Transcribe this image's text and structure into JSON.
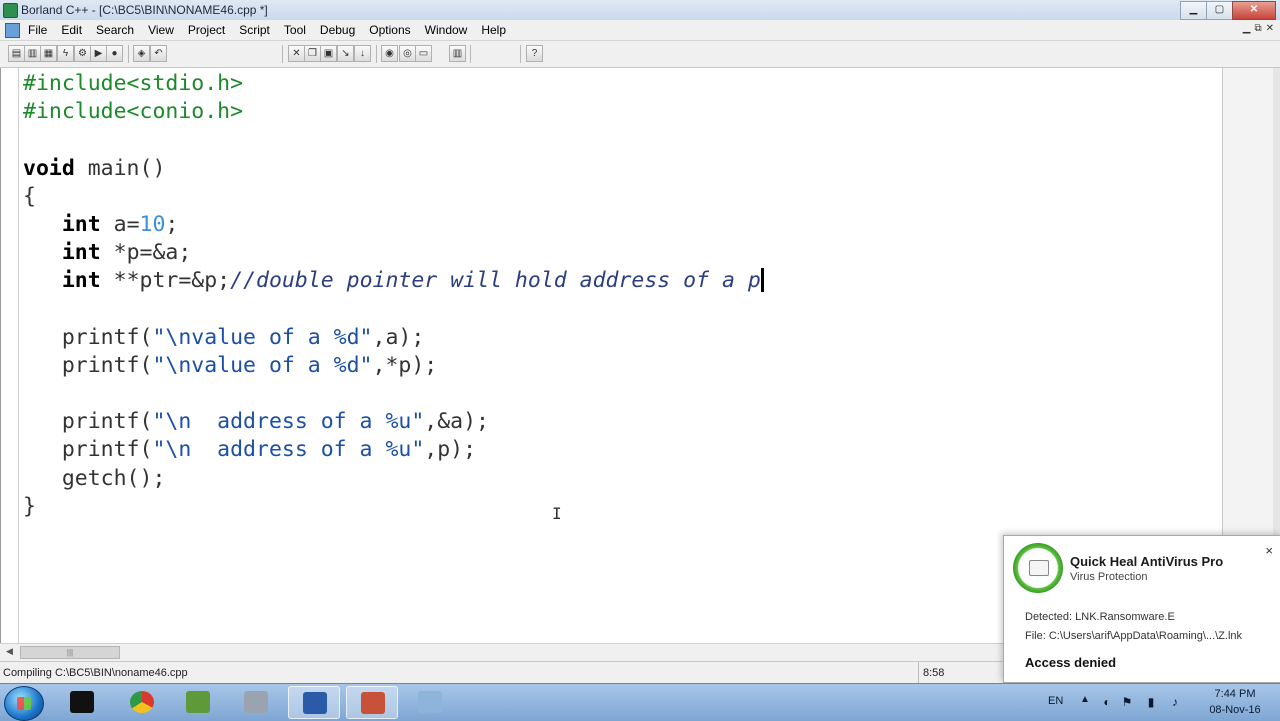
{
  "window": {
    "title": "Borland C++ - [C:\\BC5\\BIN\\NONAME46.cpp *]",
    "controls": {
      "minimize": "▁",
      "maximize": "▢",
      "close": "✕"
    },
    "mdi_controls": {
      "minimize": "▁",
      "restore": "⧉",
      "close": "✕"
    }
  },
  "menu": [
    "File",
    "Edit",
    "Search",
    "View",
    "Project",
    "Script",
    "Tool",
    "Debug",
    "Options",
    "Window",
    "Help"
  ],
  "toolbar": {
    "icons": [
      "new-icon",
      "open-icon",
      "project-icon",
      "compile-icon",
      "make-icon",
      "run-icon",
      "stop-icon",
      "debug-icon",
      "undo-icon",
      "cut-icon",
      "copy-icon",
      "paste-icon",
      "step-icon",
      "trace-icon",
      "breakpoint-icon",
      "watch-icon",
      "window-icon",
      "tile-icon",
      "help-icon"
    ]
  },
  "code": {
    "lines": [
      [
        {
          "t": "pp",
          "v": "#include<stdio.h>"
        }
      ],
      [
        {
          "t": "pp",
          "v": "#include<conio.h>"
        }
      ],
      [],
      [
        {
          "t": "kw",
          "v": "void"
        },
        {
          "t": "p",
          "v": " main()"
        }
      ],
      [
        {
          "t": "p",
          "v": "{"
        }
      ],
      [
        {
          "t": "p",
          "v": "   "
        },
        {
          "t": "kw",
          "v": "int"
        },
        {
          "t": "p",
          "v": " a="
        },
        {
          "t": "num",
          "v": "10"
        },
        {
          "t": "p",
          "v": ";"
        }
      ],
      [
        {
          "t": "p",
          "v": "   "
        },
        {
          "t": "kw",
          "v": "int"
        },
        {
          "t": "p",
          "v": " *p=&a;"
        }
      ],
      [
        {
          "t": "p",
          "v": "   "
        },
        {
          "t": "kw",
          "v": "int"
        },
        {
          "t": "p",
          "v": " **ptr=&p;"
        },
        {
          "t": "cmt",
          "v": "//double pointer will hold address of a p"
        },
        {
          "t": "caret",
          "v": ""
        }
      ],
      [],
      [
        {
          "t": "p",
          "v": "   printf("
        },
        {
          "t": "str",
          "v": "\"\\nvalue of a %d\""
        },
        {
          "t": "p",
          "v": ",a);"
        }
      ],
      [
        {
          "t": "p",
          "v": "   printf("
        },
        {
          "t": "str",
          "v": "\"\\nvalue of a %d\""
        },
        {
          "t": "p",
          "v": ",*p);"
        }
      ],
      [],
      [
        {
          "t": "p",
          "v": "   printf("
        },
        {
          "t": "str",
          "v": "\"\\n  address of a %u\""
        },
        {
          "t": "p",
          "v": ",&a);"
        }
      ],
      [
        {
          "t": "p",
          "v": "   printf("
        },
        {
          "t": "str",
          "v": "\"\\n  address of a %u\""
        },
        {
          "t": "p",
          "v": ",p);"
        }
      ],
      [
        {
          "t": "p",
          "v": "   getch();"
        }
      ],
      [
        {
          "t": "p",
          "v": "}"
        }
      ]
    ]
  },
  "statusbar": {
    "message": "Compiling C:\\BC5\\BIN\\noname46.cpp",
    "position": "8:58"
  },
  "antivirus": {
    "title": "Quick Heal AntiVirus Pro",
    "subtitle": "Virus Protection",
    "detected": "Detected: LNK.Ransomware.E",
    "file": "File: C:\\Users\\arif\\AppData\\Roaming\\...\\Z.lnk",
    "status": "Access denied",
    "close": "×"
  },
  "taskbar": {
    "apps": [
      "cmd-icon",
      "chrome-icon",
      "notepad-icon",
      "printer-icon",
      "word-icon",
      "borland-icon",
      "calculator-icon"
    ],
    "tray": {
      "lang": "EN",
      "time": "7:44 PM",
      "date": "08-Nov-16"
    }
  },
  "colors": {
    "preprocessor": "#1d8a2a",
    "number": "#3c8fd8",
    "string": "#1b4fa8",
    "comment": "#2d3e80",
    "taskbar": "#7ea6d3",
    "antivirus_ring": "#5cc23d"
  }
}
